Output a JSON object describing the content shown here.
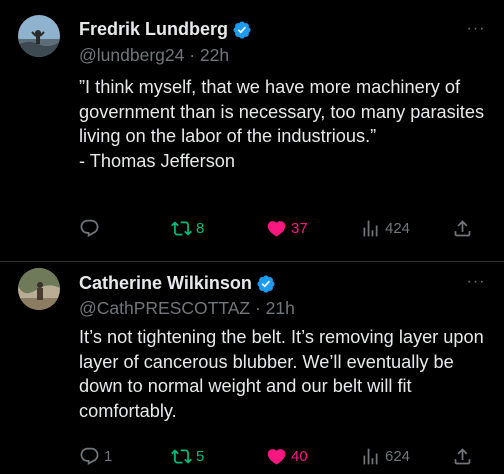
{
  "colors": {
    "background": "#000000",
    "text": "#e7e9ea",
    "muted": "#71767b",
    "verified": "#1d9bf0",
    "retweet": "#00ba7c",
    "like": "#f91880"
  },
  "tweets": [
    {
      "name": "Fredrik Lundberg",
      "handle": "@lundberg24",
      "separator": "·",
      "time": "22h",
      "more": "···",
      "text": "”I think myself, that we have more machinery of government than is necessary, too many parasites living on the labor of the industrious.”\n- Thomas Jefferson",
      "reply_count": "",
      "retweet_count": "8",
      "like_count": "37",
      "view_count": "424",
      "icons": [
        "verified-badge-icon",
        "more-icon",
        "reply-icon",
        "retweet-icon",
        "like-heart-icon",
        "views-icon",
        "share-icon"
      ]
    },
    {
      "name": "Catherine Wilkinson",
      "handle": "@CathPRESCOTTAZ",
      "separator": "·",
      "time": "21h",
      "more": "···",
      "text": "It’s not tightening the belt.  It’s removing layer upon layer of cancerous blubber.  We’ll eventually be down to normal weight and our belt will fit comfortably.",
      "reply_count": "1",
      "retweet_count": "5",
      "like_count": "40",
      "view_count": "624",
      "icons": [
        "verified-badge-icon",
        "more-icon",
        "reply-icon",
        "retweet-icon",
        "like-heart-icon",
        "views-icon",
        "share-icon"
      ]
    }
  ]
}
